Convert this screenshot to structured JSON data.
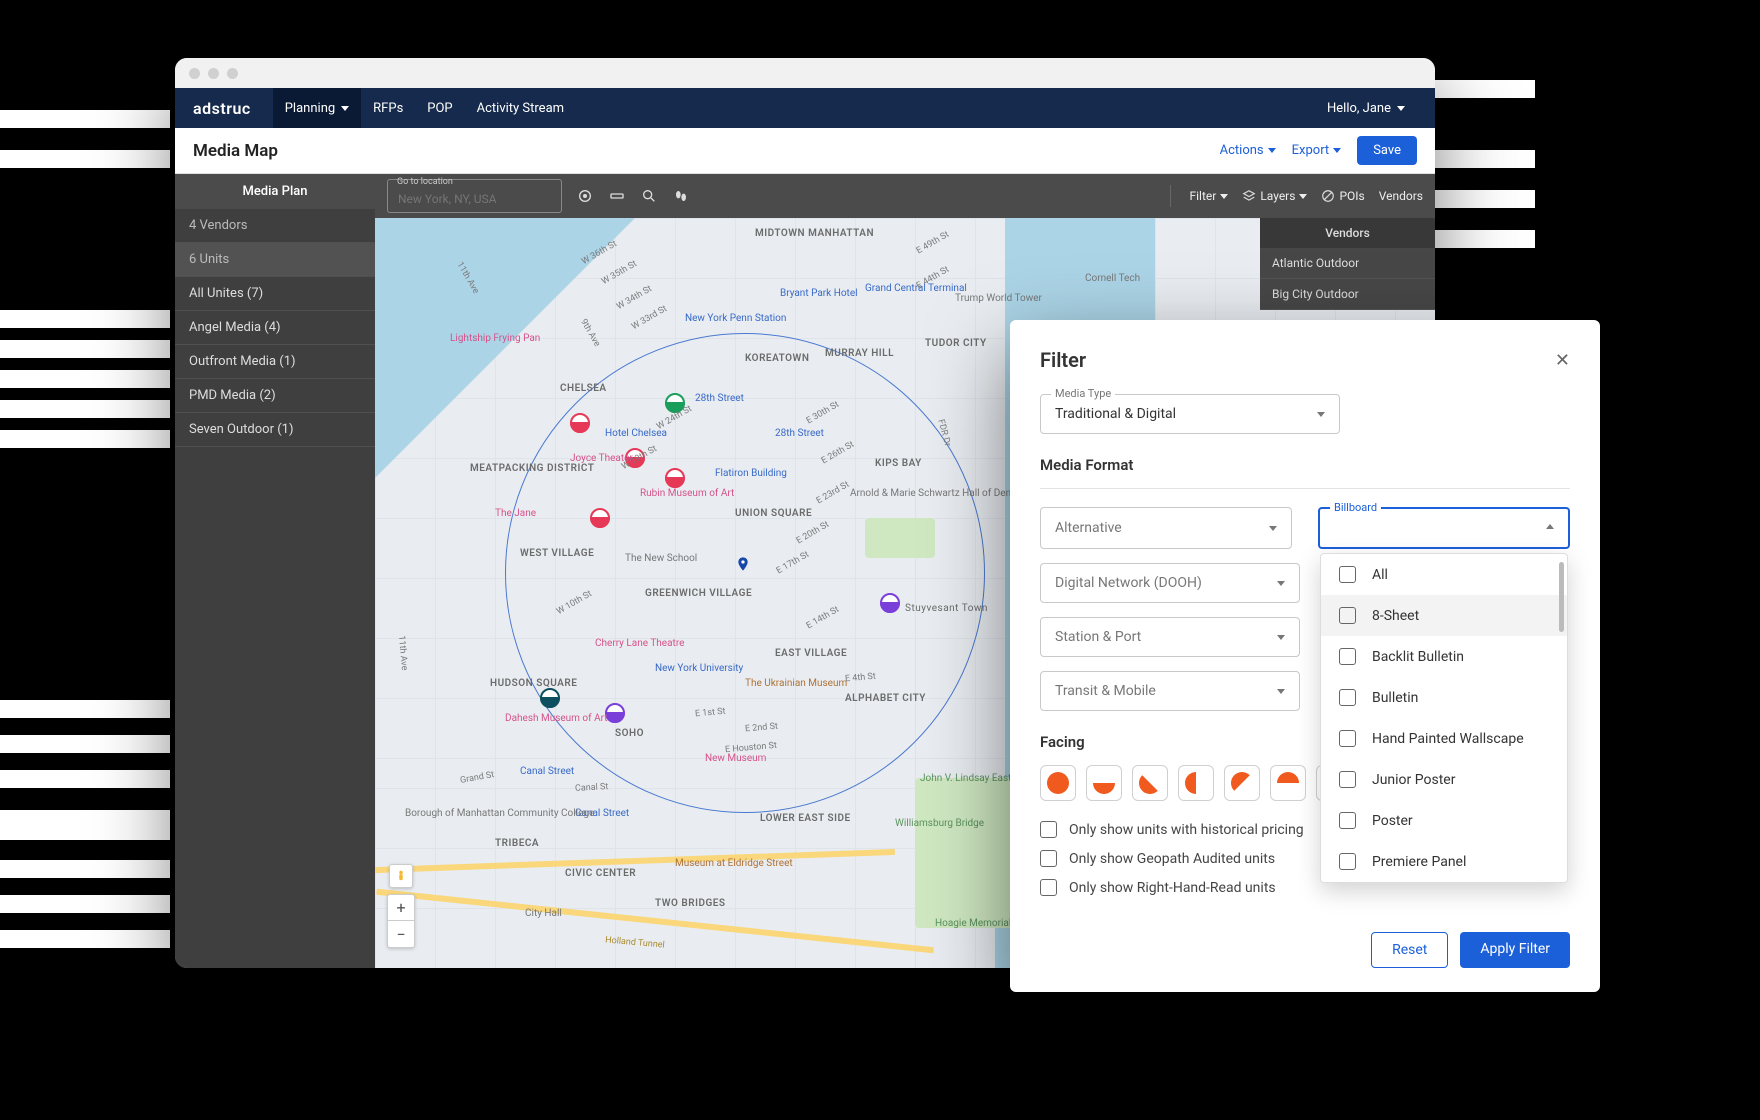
{
  "nav": {
    "brand": "adstruc",
    "items": [
      "Planning",
      "RFPs",
      "POP",
      "Activity Stream"
    ],
    "user_greeting": "Hello, Jane"
  },
  "subheader": {
    "title": "Media Map",
    "actions_label": "Actions",
    "export_label": "Export",
    "save_label": "Save"
  },
  "sidebar": {
    "heading": "Media Plan",
    "summary": [
      "4 Vendors",
      "6 Units"
    ],
    "items": [
      "All Unites (7)",
      "Angel Media (4)",
      "Outfront Media (1)",
      "PMD Media (2)",
      "Seven Outdoor (1)"
    ]
  },
  "map_toolbar": {
    "search_label": "Go to location",
    "search_placeholder": "New York, NY, USA",
    "filter_label": "Filter",
    "layers_label": "Layers",
    "pois_label": "POIs",
    "vendors_label": "Vendors"
  },
  "vendors_panel": {
    "heading": "Vendors",
    "items": [
      "Atlantic Outdoor",
      "Big City Outdoor"
    ]
  },
  "map_labels": {
    "areas": [
      "MIDTOWN MANHATTAN",
      "CHELSEA",
      "KOREATOWN",
      "MURRAY HILL",
      "TUDOR CITY",
      "MEATPACKING DISTRICT",
      "WEST VILLAGE",
      "GREENWICH VILLAGE",
      "UNION SQUARE",
      "KIPS BAY",
      "EAST VILLAGE",
      "HUDSON SQUARE",
      "SOHO",
      "ALPHABET CITY",
      "TRIBECA",
      "CIVIC CENTER",
      "TWO BRIDGES",
      "LOWER EAST SIDE",
      "Stuyvesant Town"
    ],
    "places": [
      "New York Penn Station",
      "Bryant Park Hotel",
      "Grand Central Terminal",
      "Trump World Tower",
      "Cornell Tech",
      "Hotel Chelsea",
      "28th Street",
      "28th Street",
      "Flatiron Building",
      "Arnold & Marie Schwartz Hall of Dental Science",
      "The New School",
      "New York University",
      "The Ukrainian Museum",
      "Canal Street",
      "Canal Street",
      "Museum at Eldridge Street",
      "Williamsburg Bridge",
      "John V. Lindsay East River Park"
    ],
    "poi_pink": [
      "Lightship Frying Pan",
      "Joyce Theater",
      "Rubin Museum of Art",
      "The Jane",
      "Cherry Lane Theatre",
      "Dahesh Museum of Art",
      "New Museum"
    ],
    "streets": [
      "W 36th St",
      "W 35th St",
      "W 34th St",
      "W 33rd St",
      "11th Ave",
      "9th Ave",
      "W 24th St",
      "W 19th St",
      "E 30th St",
      "E 26th St",
      "E 23rd St",
      "E 20th St",
      "E 17th St",
      "E 14th St",
      "E 49th St",
      "E 44th St",
      "FDR Dr",
      "Grand St",
      "E Houston St",
      "E 4th St",
      "E 1st St",
      "E 2nd St",
      "W 10th St",
      "Canal St",
      "11th Ave",
      "Holland Tunnel"
    ],
    "east_places": [
      "Borough of Manhattan Community College",
      "City Hall",
      "Hoagie Memorial"
    ]
  },
  "filter": {
    "title": "Filter",
    "media_type_label": "Media Type",
    "media_type_value": "Traditional & Digital",
    "media_format_label": "Media Format",
    "format_selects": [
      "Alternative",
      "Digital Network (DOOH)",
      "Station & Port",
      "Transit & Mobile"
    ],
    "billboard_label": "Billboard",
    "billboard_options": [
      "All",
      "8-Sheet",
      "Backlit Bulletin",
      "Bulletin",
      "Hand Painted Wallscape",
      "Junior Poster",
      "Poster",
      "Premiere Panel"
    ],
    "facing_label": "Facing",
    "checks": [
      "Only show units with historical pricing",
      "Only show Geopath Audited units",
      "Only show Right-Hand-Read units"
    ],
    "reset_label": "Reset",
    "apply_label": "Apply Filter"
  }
}
